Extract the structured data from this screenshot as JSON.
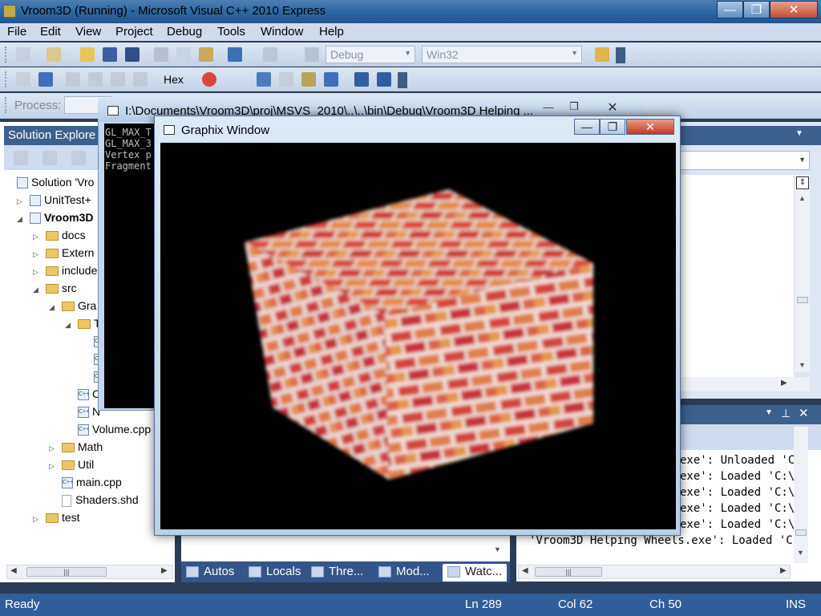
{
  "window": {
    "title": "Vroom3D (Running) - Microsoft Visual C++ 2010 Express",
    "min_glyph": "—",
    "max_glyph": "❐",
    "close_glyph": "✕"
  },
  "menu": [
    "File",
    "Edit",
    "View",
    "Project",
    "Debug",
    "Tools",
    "Window",
    "Help"
  ],
  "toolbar": {
    "config_combo": "Debug",
    "platform_combo": "Win32",
    "hex_label": "Hex",
    "process_label": "Process:"
  },
  "solution_explorer": {
    "title": "Solution Explore",
    "tree": [
      {
        "label": "Solution 'Vro",
        "icon": "solution-icon",
        "depth": 0
      },
      {
        "label": "UnitTest+",
        "icon": "project-icon",
        "depth": 1,
        "expander": "▷"
      },
      {
        "label": "Vroom3D",
        "icon": "project-icon",
        "depth": 1,
        "expander": "◢",
        "bold": true
      },
      {
        "label": "docs",
        "icon": "folder-icon",
        "depth": 2,
        "expander": "▷"
      },
      {
        "label": "Extern",
        "icon": "folder-icon",
        "depth": 2,
        "expander": "▷"
      },
      {
        "label": "include",
        "icon": "folder-icon",
        "depth": 2,
        "expander": "▷"
      },
      {
        "label": "src",
        "icon": "folder-icon",
        "depth": 2,
        "expander": "◢"
      },
      {
        "label": "Gra",
        "icon": "folder-icon",
        "depth": 3,
        "expander": "◢"
      },
      {
        "label": "T",
        "icon": "folder-icon",
        "depth": 4,
        "expander": "◢"
      },
      {
        "label": "",
        "icon": "cpp-icon",
        "depth": 5
      },
      {
        "label": "",
        "icon": "cpp-icon",
        "depth": 5
      },
      {
        "label": "",
        "icon": "cpp-icon",
        "depth": 5
      },
      {
        "label": "C",
        "icon": "cpp-icon",
        "depth": 4
      },
      {
        "label": "N",
        "icon": "cpp-icon",
        "depth": 4
      },
      {
        "label": "Volume.cpp",
        "icon": "cpp-icon",
        "depth": 4
      },
      {
        "label": "Math",
        "icon": "folder-icon",
        "depth": 3,
        "expander": "▷"
      },
      {
        "label": "Util",
        "icon": "folder-icon",
        "depth": 3,
        "expander": "▷"
      },
      {
        "label": "main.cpp",
        "icon": "cpp-icon",
        "depth": 3
      },
      {
        "label": "Shaders.shd",
        "icon": "file-icon",
        "depth": 3
      },
      {
        "label": "test",
        "icon": "folder-icon",
        "depth": 2,
        "expander": "▷"
      }
    ]
  },
  "console": {
    "title": "I:\\Documents\\Vroom3D\\proj\\MSVS_2010\\..\\..\\bin\\Debug\\Vroom3D Helping ...",
    "lines": [
      "GL_MAX_T",
      "GL_MAX_3",
      "Vertex p",
      "Fragment"
    ]
  },
  "graphix_window": {
    "title": "Graphix Window"
  },
  "output": {
    "lines": [
      "exe': Unloaded 'C",
      "exe': Loaded 'C:\\",
      "exe': Loaded 'C:\\",
      "exe': Loaded 'C:\\",
      "exe': Loaded 'C:\\",
      "'Vroom3D Helping Wheels.exe': Loaded 'C:\\"
    ]
  },
  "bottom_tabs": [
    {
      "label": "Autos",
      "active": false
    },
    {
      "label": "Locals",
      "active": false
    },
    {
      "label": "Thre...",
      "active": false
    },
    {
      "label": "Mod...",
      "active": false
    },
    {
      "label": "Watc...",
      "active": true
    }
  ],
  "status": {
    "ready": "Ready",
    "line": "Ln 289",
    "col": "Col 62",
    "ch": "Ch 50",
    "ins": "INS"
  },
  "colors": {
    "title_bar": "#2f6aa5",
    "close_button": "#c0392b",
    "brick_light": "#e07a4a",
    "brick_dark": "#c2352e"
  }
}
